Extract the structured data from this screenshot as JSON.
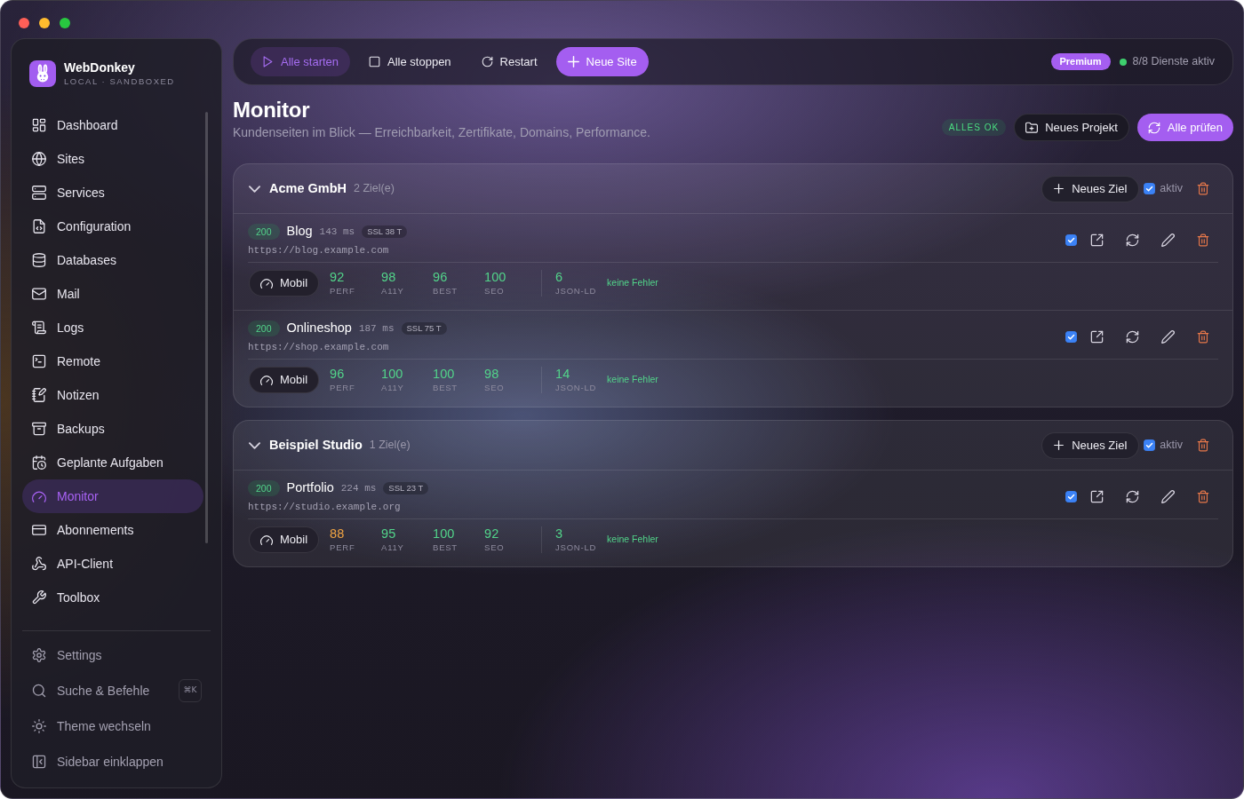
{
  "sidebar": {
    "brand": {
      "name": "WebDonkey",
      "tagline": "LOCAL · SANDBOXED"
    },
    "items": [
      {
        "label": "Dashboard",
        "selected": false
      },
      {
        "label": "Sites",
        "selected": false
      },
      {
        "label": "Services",
        "selected": false
      },
      {
        "label": "Configuration",
        "selected": false
      },
      {
        "label": "Databases",
        "selected": false
      },
      {
        "label": "Mail",
        "selected": false
      },
      {
        "label": "Logs",
        "selected": false
      },
      {
        "label": "Remote",
        "selected": false
      },
      {
        "label": "Notizen",
        "selected": false
      },
      {
        "label": "Backups",
        "selected": false
      },
      {
        "label": "Geplante Aufgaben",
        "selected": false
      },
      {
        "label": "Monitor",
        "selected": true
      },
      {
        "label": "Abonnements",
        "selected": false
      },
      {
        "label": "API-Client",
        "selected": false
      },
      {
        "label": "Toolbox",
        "selected": false
      }
    ],
    "footer_items": [
      {
        "label": "Settings"
      },
      {
        "label": "Suche & Befehle",
        "shortcut": "⌘K"
      },
      {
        "label": "Theme wechseln"
      },
      {
        "label": "Sidebar einklappen"
      }
    ]
  },
  "toolbar": {
    "buttons": [
      {
        "label": "Alle starten",
        "kind": "soft"
      },
      {
        "label": "Alle stoppen",
        "kind": "plain"
      },
      {
        "label": "Restart",
        "kind": "plain"
      },
      {
        "label": "Neue Site",
        "kind": "primary"
      }
    ],
    "plan_badge": "Premium",
    "services": {
      "text": "8/8 Dienste aktiv",
      "ok": true
    }
  },
  "page": {
    "title": "Monitor",
    "subtitle": "Kundenseiten im Blick — Erreichbarkeit, Zertifikate, Domains, Performance.",
    "status_badge": "ALLES OK",
    "actions": [
      {
        "label": "Neues Projekt",
        "kind": "outline"
      },
      {
        "label": "Alle prüfen",
        "kind": "primary"
      }
    ]
  },
  "groups": [
    {
      "name": "Acme GmbH",
      "count": "2 Ziel(e)",
      "expanded": true,
      "add_label": "Neues Ziel",
      "active": true,
      "active_label": "aktiv",
      "targets": [
        {
          "status": "200",
          "name": "Blog",
          "latency": "143 ms",
          "ssl": "SSL 38 T",
          "url": "https://blog.example.com",
          "checked": true,
          "device": "Mobil",
          "scores": [
            {
              "value": "92",
              "label": "PERF",
              "color": "#52d48a"
            },
            {
              "value": "98",
              "label": "A11Y",
              "color": "#52d48a"
            },
            {
              "value": "96",
              "label": "BEST",
              "color": "#52d48a"
            },
            {
              "value": "100",
              "label": "SEO",
              "color": "#52d48a"
            }
          ],
          "json_ld": {
            "value": "6",
            "label": "JSON-LD"
          },
          "errors": "keine Fehler"
        },
        {
          "status": "200",
          "name": "Onlineshop",
          "latency": "187 ms",
          "ssl": "SSL 75 T",
          "url": "https://shop.example.com",
          "checked": true,
          "device": "Mobil",
          "scores": [
            {
              "value": "96",
              "label": "PERF",
              "color": "#52d48a"
            },
            {
              "value": "100",
              "label": "A11Y",
              "color": "#52d48a"
            },
            {
              "value": "100",
              "label": "BEST",
              "color": "#52d48a"
            },
            {
              "value": "98",
              "label": "SEO",
              "color": "#52d48a"
            }
          ],
          "json_ld": {
            "value": "14",
            "label": "JSON-LD"
          },
          "errors": "keine Fehler"
        }
      ]
    },
    {
      "name": "Beispiel Studio",
      "count": "1 Ziel(e)",
      "expanded": true,
      "add_label": "Neues Ziel",
      "active": true,
      "active_label": "aktiv",
      "targets": [
        {
          "status": "200",
          "name": "Portfolio",
          "latency": "224 ms",
          "ssl": "SSL 23 T",
          "url": "https://studio.example.org",
          "checked": true,
          "device": "Mobil",
          "scores": [
            {
              "value": "88",
              "label": "PERF",
              "color": "#f0a443"
            },
            {
              "value": "95",
              "label": "A11Y",
              "color": "#52d48a"
            },
            {
              "value": "100",
              "label": "BEST",
              "color": "#52d48a"
            },
            {
              "value": "92",
              "label": "SEO",
              "color": "#52d48a"
            }
          ],
          "json_ld": {
            "value": "3",
            "label": "JSON-LD"
          },
          "errors": "keine Fehler"
        }
      ]
    }
  ]
}
